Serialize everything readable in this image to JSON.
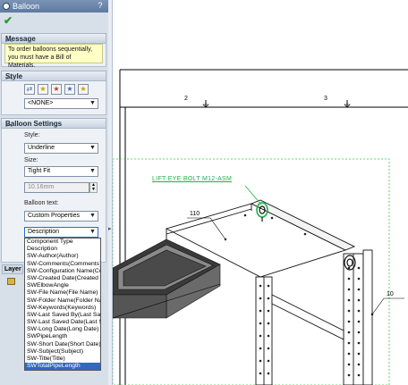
{
  "panel": {
    "title": "Balloon",
    "help": "?",
    "message_header": "Message",
    "message_text": "To order balloons sequentially, you must have a Bill of Materials.",
    "style_header": "Style",
    "style_select": "<NONE>",
    "settings_header": "Balloon Settings",
    "style_label": "Style:",
    "style_value": "Underline",
    "size_label": "Size:",
    "size_value": "Tight Fit",
    "size_field": "10.16mm",
    "balloon_text_label": "Balloon text:",
    "balloon_text_value": "Custom Properties",
    "property_value": "Description",
    "layer_header": "Layer",
    "dropdown_options": [
      "Component Type",
      "Description",
      "SW-Author(Author)",
      "SW-Comments(Comments)",
      "SW-Configuration Name(Configuration Name)",
      "SW-Created Date(Created Date)",
      "SWElbowAngle",
      "SW-File Name(File Name)",
      "SW-Folder Name(Folder Name)",
      "SW-Keywords(Keywords)",
      "SW-Last Saved By(Last Saved By)",
      "SW-Last Saved Date(Last Saved Date)",
      "SW-Long Date(Long Date)",
      "SWPipeLength",
      "SW-Short Date(Short Date)",
      "SW-Subject(Subject)",
      "SW-Title(Title)",
      "SWTotalPipeLength"
    ],
    "selected_option": "SWTotalPipeLength"
  },
  "drawing": {
    "zone_left": "2",
    "zone_right": "3",
    "note": "LIFT EYE BOLT M12-ASM",
    "balloon_1": "110",
    "balloon_2": "10"
  },
  "colors": {
    "note": "#19b34a",
    "selection": "#3168c6",
    "message_bg": "#ffffc6"
  }
}
